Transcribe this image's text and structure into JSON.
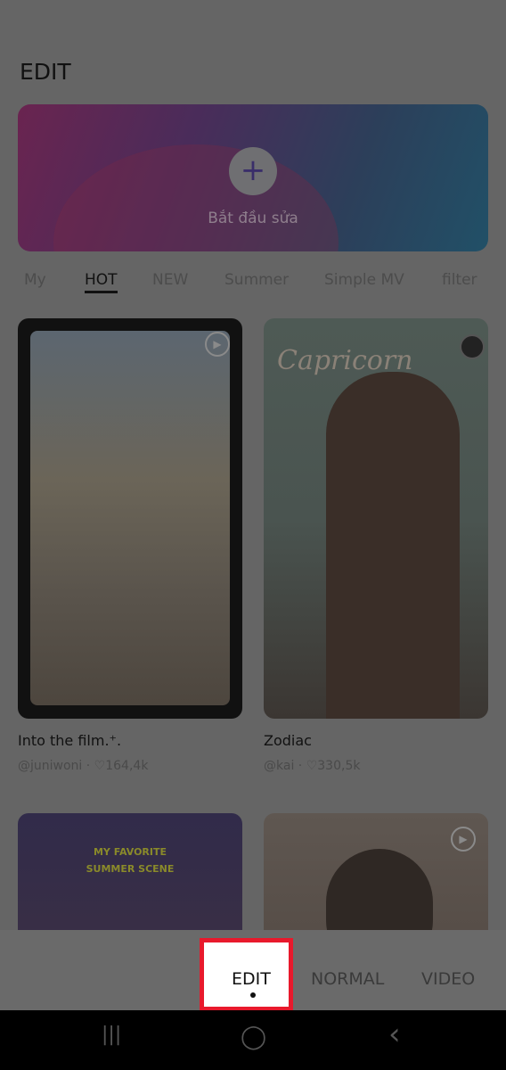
{
  "header": {
    "title": "EDIT"
  },
  "banner": {
    "plus_icon": "plus-icon",
    "label": "Bắt đầu sửa"
  },
  "tabs": [
    {
      "label": "My"
    },
    {
      "label": "HOT",
      "active": true
    },
    {
      "label": "NEW"
    },
    {
      "label": "Summer"
    },
    {
      "label": "Simple MV"
    },
    {
      "label": "filter"
    }
  ],
  "cards": [
    {
      "title": "Into the film.⁺.",
      "author": "@juniwoni",
      "likes": "164,4k"
    },
    {
      "title": "Zodiac",
      "author": "@kai",
      "likes": "330,5k",
      "image_text": "Capricorn"
    },
    {
      "image_text": "MY FAVORITE SUMMER SCENE"
    },
    {}
  ],
  "bottom_modes": [
    {
      "label": "EDIT",
      "active": true
    },
    {
      "label": "NORMAL"
    },
    {
      "label": "VIDEO"
    }
  ],
  "colors": {
    "highlight": "#e8192c"
  },
  "nav": {
    "recents": "|||",
    "home": "◯",
    "back": "‹"
  }
}
